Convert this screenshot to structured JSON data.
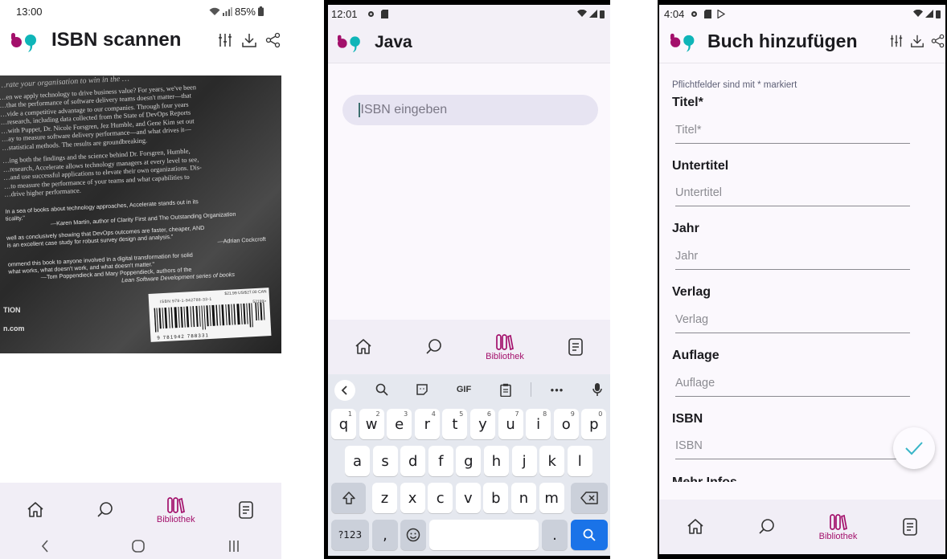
{
  "colors": {
    "brand_pink": "#a3106b",
    "brand_teal": "#0fb5b8",
    "accent_blue": "#1a73e8"
  },
  "phone1": {
    "status": {
      "time": "13:00",
      "battery": "85%"
    },
    "title": "ISBN scannen",
    "photo": {
      "lines": [
        "…rate your organisation to win in the …",
        "…en we apply technology to drive business value? For years, we've been",
        "…that the performance of software delivery teams doesn't matter—that",
        "…vide a competitive advantage to our companies. Through four years",
        "…research, including data collected from the State of DevOps Reports",
        "…with Puppet, Dr. Nicole Forsgren, Jez Humble, and Gene Kim set out",
        "…ay to measure software delivery performance—and what drives it—",
        "…statistical methods. The results are groundbreaking.",
        "…ing both the findings and the science behind Dr. Forsgren, Humble,",
        "…research, Accelerate allows technology managers at every level to see,",
        "…and use successful applications to elevate their own organizations. Dis-",
        "…to measure the performance of your teams and what capabilities to",
        "…drive higher performance."
      ],
      "quotes": [
        "In a sea of books about technology approaches, Accelerate stands out in its",
        "ticality.\"",
        "—Karen Martin, author of Clarity First and The Outstanding Organization",
        "well as conclusively showing that DevOps outcomes are faster, cheaper, AND",
        "is an excellent case study for robust survey design and analysis.\"",
        "—Adrian Cockcroft",
        "ommend this book to anyone involved in a digital transformation for solid",
        "what works, what doesn't work, and what doesn't matter.\"",
        "—Tom Poppendieck and Mary Poppendieck, authors of the",
        "Lean Software Development series of books"
      ],
      "price": "$21.99 US/$27.00 CAN",
      "isbn": "ISBN 978-1-942788-33-1",
      "barcode_digits": "9 781942 788331",
      "price_code": "52199>",
      "footer_left1": "TION",
      "footer_left2": "n.com"
    },
    "nav": [
      {
        "icon": "home-icon",
        "label": ""
      },
      {
        "icon": "search-icon",
        "label": ""
      },
      {
        "icon": "library-icon",
        "label": "Bibliothek"
      },
      {
        "icon": "list-icon",
        "label": ""
      }
    ]
  },
  "phone2": {
    "status": {
      "time": "12:01"
    },
    "title": "Java",
    "isbn_placeholder": "ISBN eingeben",
    "nav": [
      {
        "icon": "home-icon",
        "label": ""
      },
      {
        "icon": "search-icon",
        "label": ""
      },
      {
        "icon": "library-icon",
        "label": "Bibliothek"
      },
      {
        "icon": "list-icon",
        "label": ""
      }
    ],
    "keyboard": {
      "toolbar": [
        "<",
        "search",
        "sticker",
        "GIF",
        "clipboard",
        "more",
        "mic"
      ],
      "row1": [
        {
          "k": "q",
          "s": "1"
        },
        {
          "k": "w",
          "s": "2"
        },
        {
          "k": "e",
          "s": "3"
        },
        {
          "k": "r",
          "s": "4"
        },
        {
          "k": "t",
          "s": "5"
        },
        {
          "k": "y",
          "s": "6"
        },
        {
          "k": "u",
          "s": "7"
        },
        {
          "k": "i",
          "s": "8"
        },
        {
          "k": "o",
          "s": "9"
        },
        {
          "k": "p",
          "s": "0"
        }
      ],
      "row2": [
        "a",
        "s",
        "d",
        "f",
        "g",
        "h",
        "j",
        "k",
        "l"
      ],
      "row3": [
        "z",
        "x",
        "c",
        "v",
        "b",
        "n",
        "m"
      ],
      "symbols_key": "?123",
      "comma_key": ",",
      "period_key": "."
    }
  },
  "phone3": {
    "status": {
      "time": "4:04"
    },
    "title": "Buch hinzufügen",
    "hint": "Pflichtfelder sind mit * markiert",
    "fields": [
      {
        "label": "Titel*",
        "placeholder": "Titel*"
      },
      {
        "label": "Untertitel",
        "placeholder": "Untertitel"
      },
      {
        "label": "Jahr",
        "placeholder": "Jahr"
      },
      {
        "label": "Verlag",
        "placeholder": "Verlag"
      },
      {
        "label": "Auflage",
        "placeholder": "Auflage"
      },
      {
        "label": "ISBN",
        "placeholder": "ISBN"
      }
    ],
    "cut_label": "Mehr Infos",
    "nav": [
      {
        "icon": "home-icon",
        "label": ""
      },
      {
        "icon": "search-icon",
        "label": ""
      },
      {
        "icon": "library-icon",
        "label": "Bibliothek"
      },
      {
        "icon": "list-icon",
        "label": ""
      }
    ]
  }
}
